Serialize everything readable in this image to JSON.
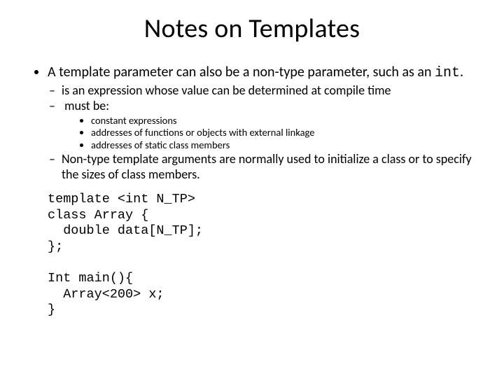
{
  "title": "Notes on Templates",
  "bullets": {
    "lvl1_prefix": "A template parameter can also be a non-type parameter, such as an ",
    "lvl1_code": "int",
    "lvl1_suffix": ".",
    "lvl2": [
      "is an expression whose value can be determined at compile time",
      "must be:"
    ],
    "lvl3": [
      "constant expressions",
      "addresses of functions or objects with external linkage",
      "addresses of static class members"
    ],
    "lvl2b": "Non-type template arguments are normally used to initialize a class or to specify the sizes of class members."
  },
  "code": "template <int N_TP>\nclass Array {\n  double data[N_TP];\n};\n\nInt main(){\n  Array<200> x;\n}"
}
